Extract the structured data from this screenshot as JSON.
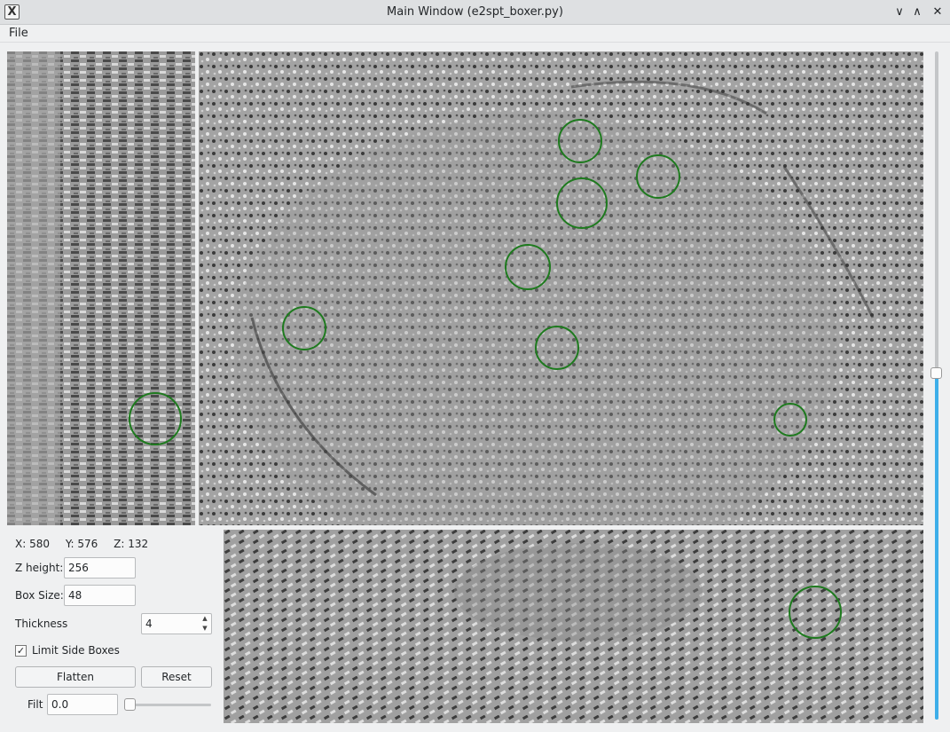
{
  "window": {
    "title": "Main Window (e2spt_boxer.py)",
    "app_icon": "X",
    "buttons": {
      "minimize": "∨",
      "maximize": "∧",
      "close": "✕"
    }
  },
  "menu": {
    "file": "File"
  },
  "coords": {
    "x": "X: 580",
    "y": "Y: 576",
    "z": "Z: 132"
  },
  "controls": {
    "z_height_label": "Z height:",
    "z_height_value": "256",
    "box_size_label": "Box Size:",
    "box_size_value": "48",
    "thickness_label": "Thickness",
    "thickness_value": "4",
    "limit_side_boxes_label": "Limit Side Boxes",
    "limit_side_boxes_checked": "✓",
    "flatten_button": "Flatten",
    "reset_button": "Reset",
    "filt_label": "Filt",
    "filt_value": "0.0",
    "filt_slider_value": 0
  },
  "z_slider_fraction": 0.48,
  "colors": {
    "box_circle": "#1e7a1e",
    "slider_accent": "#3daee9"
  },
  "icons": [
    "app-icon",
    "minimize-icon",
    "maximize-icon",
    "close-icon",
    "spin-up-icon",
    "spin-down-icon",
    "checkmark-icon"
  ]
}
